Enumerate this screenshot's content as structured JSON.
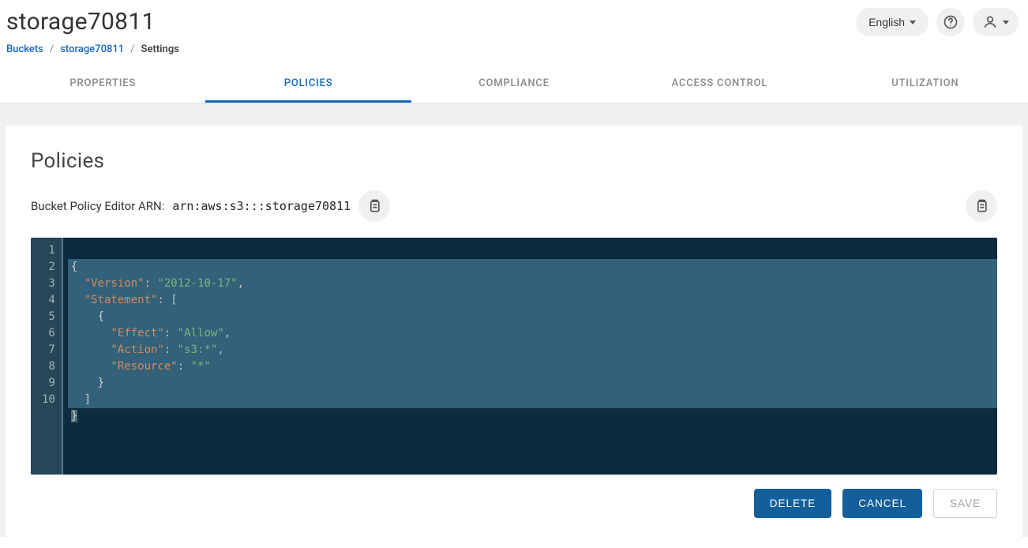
{
  "header": {
    "title": "storage70811",
    "language_label": "English"
  },
  "breadcrumb": {
    "root": "Buckets",
    "bucket": "storage70811",
    "current": "Settings"
  },
  "tabs": {
    "properties": "PROPERTIES",
    "policies": "POLICIES",
    "compliance": "COMPLIANCE",
    "access_control": "ACCESS CONTROL",
    "utilization": "UTILIZATION"
  },
  "policies": {
    "section_title": "Policies",
    "arn_label": "Bucket Policy Editor ARN:",
    "arn_value": "arn:aws:s3:::storage70811",
    "editor_lines": [
      "1",
      "2",
      "3",
      "4",
      "5",
      "6",
      "7",
      "8",
      "9",
      "10"
    ],
    "policy_json": {
      "Version": "2012-10-17",
      "Statement": [
        {
          "Effect": "Allow",
          "Action": "s3:*",
          "Resource": "*"
        }
      ]
    },
    "code_tokens": {
      "l1": {
        "a": "{"
      },
      "l2": {
        "k": "\"Version\"",
        "p": ": ",
        "v": "\"2012-10-17\"",
        "c": ","
      },
      "l3": {
        "k": "\"Statement\"",
        "p": ": [",
        "c": ""
      },
      "l4": {
        "a": "    {"
      },
      "l5": {
        "k": "\"Effect\"",
        "p": ": ",
        "v": "\"Allow\"",
        "c": ","
      },
      "l6": {
        "k": "\"Action\"",
        "p": ": ",
        "v": "\"s3:*\"",
        "c": ","
      },
      "l7": {
        "k": "\"Resource\"",
        "p": ": ",
        "v": "\"*\"",
        "c": ""
      },
      "l8": {
        "a": "    }"
      },
      "l9": {
        "a": "  ]"
      },
      "l10": {
        "a": "}"
      }
    }
  },
  "actions": {
    "delete": "DELETE",
    "cancel": "CANCEL",
    "save": "SAVE"
  }
}
